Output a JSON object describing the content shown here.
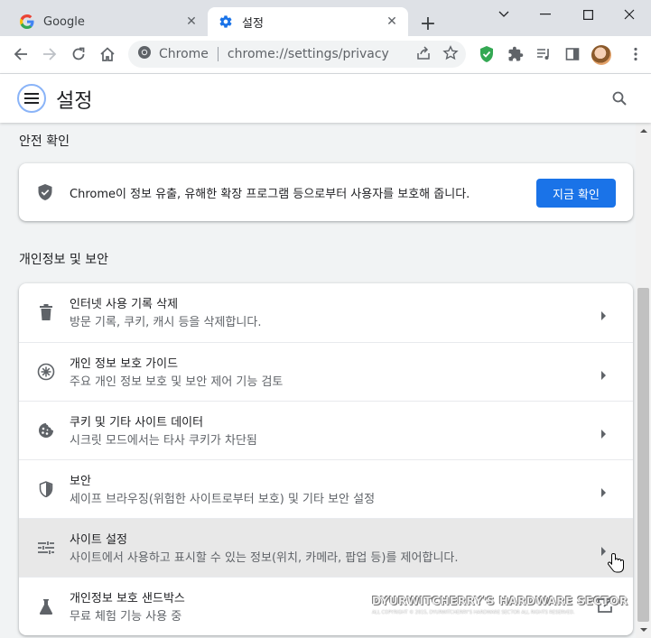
{
  "tabs": [
    {
      "title": "Google",
      "active": false
    },
    {
      "title": "설정",
      "active": true
    }
  ],
  "toolbar": {
    "omnibox_chrome_label": "Chrome",
    "url_scheme": "chrome://",
    "url_path": "settings/privacy"
  },
  "header": {
    "title": "설정"
  },
  "safety_check": {
    "section_title": "안전 확인",
    "description": "Chrome이 정보 유출, 유해한 확장 프로그램 등으로부터 사용자를 보호해 줍니다.",
    "button_label": "지금 확인"
  },
  "privacy": {
    "section_title": "개인정보 및 보안",
    "items": [
      {
        "title": "인터넷 사용 기록 삭제",
        "subtitle": "방문 기록, 쿠키, 캐시 등을 삭제합니다.",
        "icon": "trash-icon"
      },
      {
        "title": "개인 정보 보호 가이드",
        "subtitle": "주요 개인 정보 보호 및 보안 제어 기능 검토",
        "icon": "compass-icon"
      },
      {
        "title": "쿠키 및 기타 사이트 데이터",
        "subtitle": "시크릿 모드에서는 타사 쿠키가 차단됨",
        "icon": "cookie-icon"
      },
      {
        "title": "보안",
        "subtitle": "세이프 브라우징(위험한 사이트로부터 보호) 및 기타 보안 설정",
        "icon": "shield-icon"
      },
      {
        "title": "사이트 설정",
        "subtitle": "사이트에서 사용하고 표시할 수 있는 정보(위치, 카메라, 팝업 등)를 제어합니다.",
        "icon": "tune-icon"
      },
      {
        "title": "개인정보 보호 샌드박스",
        "subtitle": "무료 체험 기능 사용 중",
        "icon": "flask-icon"
      }
    ]
  },
  "watermark": {
    "line1": "DYURWITCHERRY'S HARDWARE SECTOR",
    "line2": "ALL COPYRIGHT © 2015, DYURWITCHERRY'S HARDWARE SECTOR ALL RIGHTS RESERVED."
  },
  "colors": {
    "accent": "#1a73e8",
    "shield_green": "#34a853",
    "background": "#f1f3f4"
  }
}
